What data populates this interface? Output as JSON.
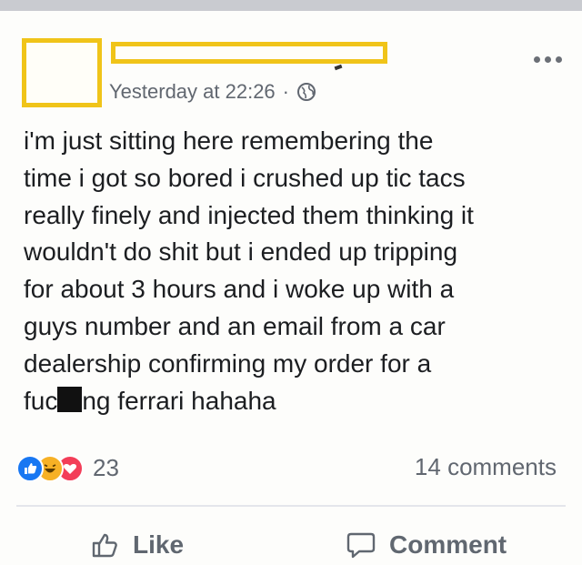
{
  "post": {
    "timestamp": "Yesterday at 22:26",
    "separator": "·",
    "privacy_icon": "globe-icon",
    "lines": [
      "i'm just sitting here remembering the",
      "time i got so bored i crushed up tic tacs",
      "really finely and injected them thinking it",
      "wouldn't do shit but i ended up tripping",
      "for about 3 hours and i woke up with a",
      "guys number and an email from a car",
      "dealership confirming my order for a"
    ],
    "last_line_prefix": "fuc",
    "last_line_suffix": "ng ferrari hahaha"
  },
  "reactions": {
    "icons": [
      "like-icon",
      "haha-icon",
      "love-icon"
    ],
    "count": "23",
    "comments": "14 comments"
  },
  "actions": {
    "like_label": "Like",
    "comment_label": "Comment"
  },
  "colors": {
    "highlight_box": "#f0c419",
    "like_blue": "#1877f2",
    "love_red": "#f33e58",
    "haha_yellow": "#f7b125",
    "meta_gray": "#616770"
  }
}
